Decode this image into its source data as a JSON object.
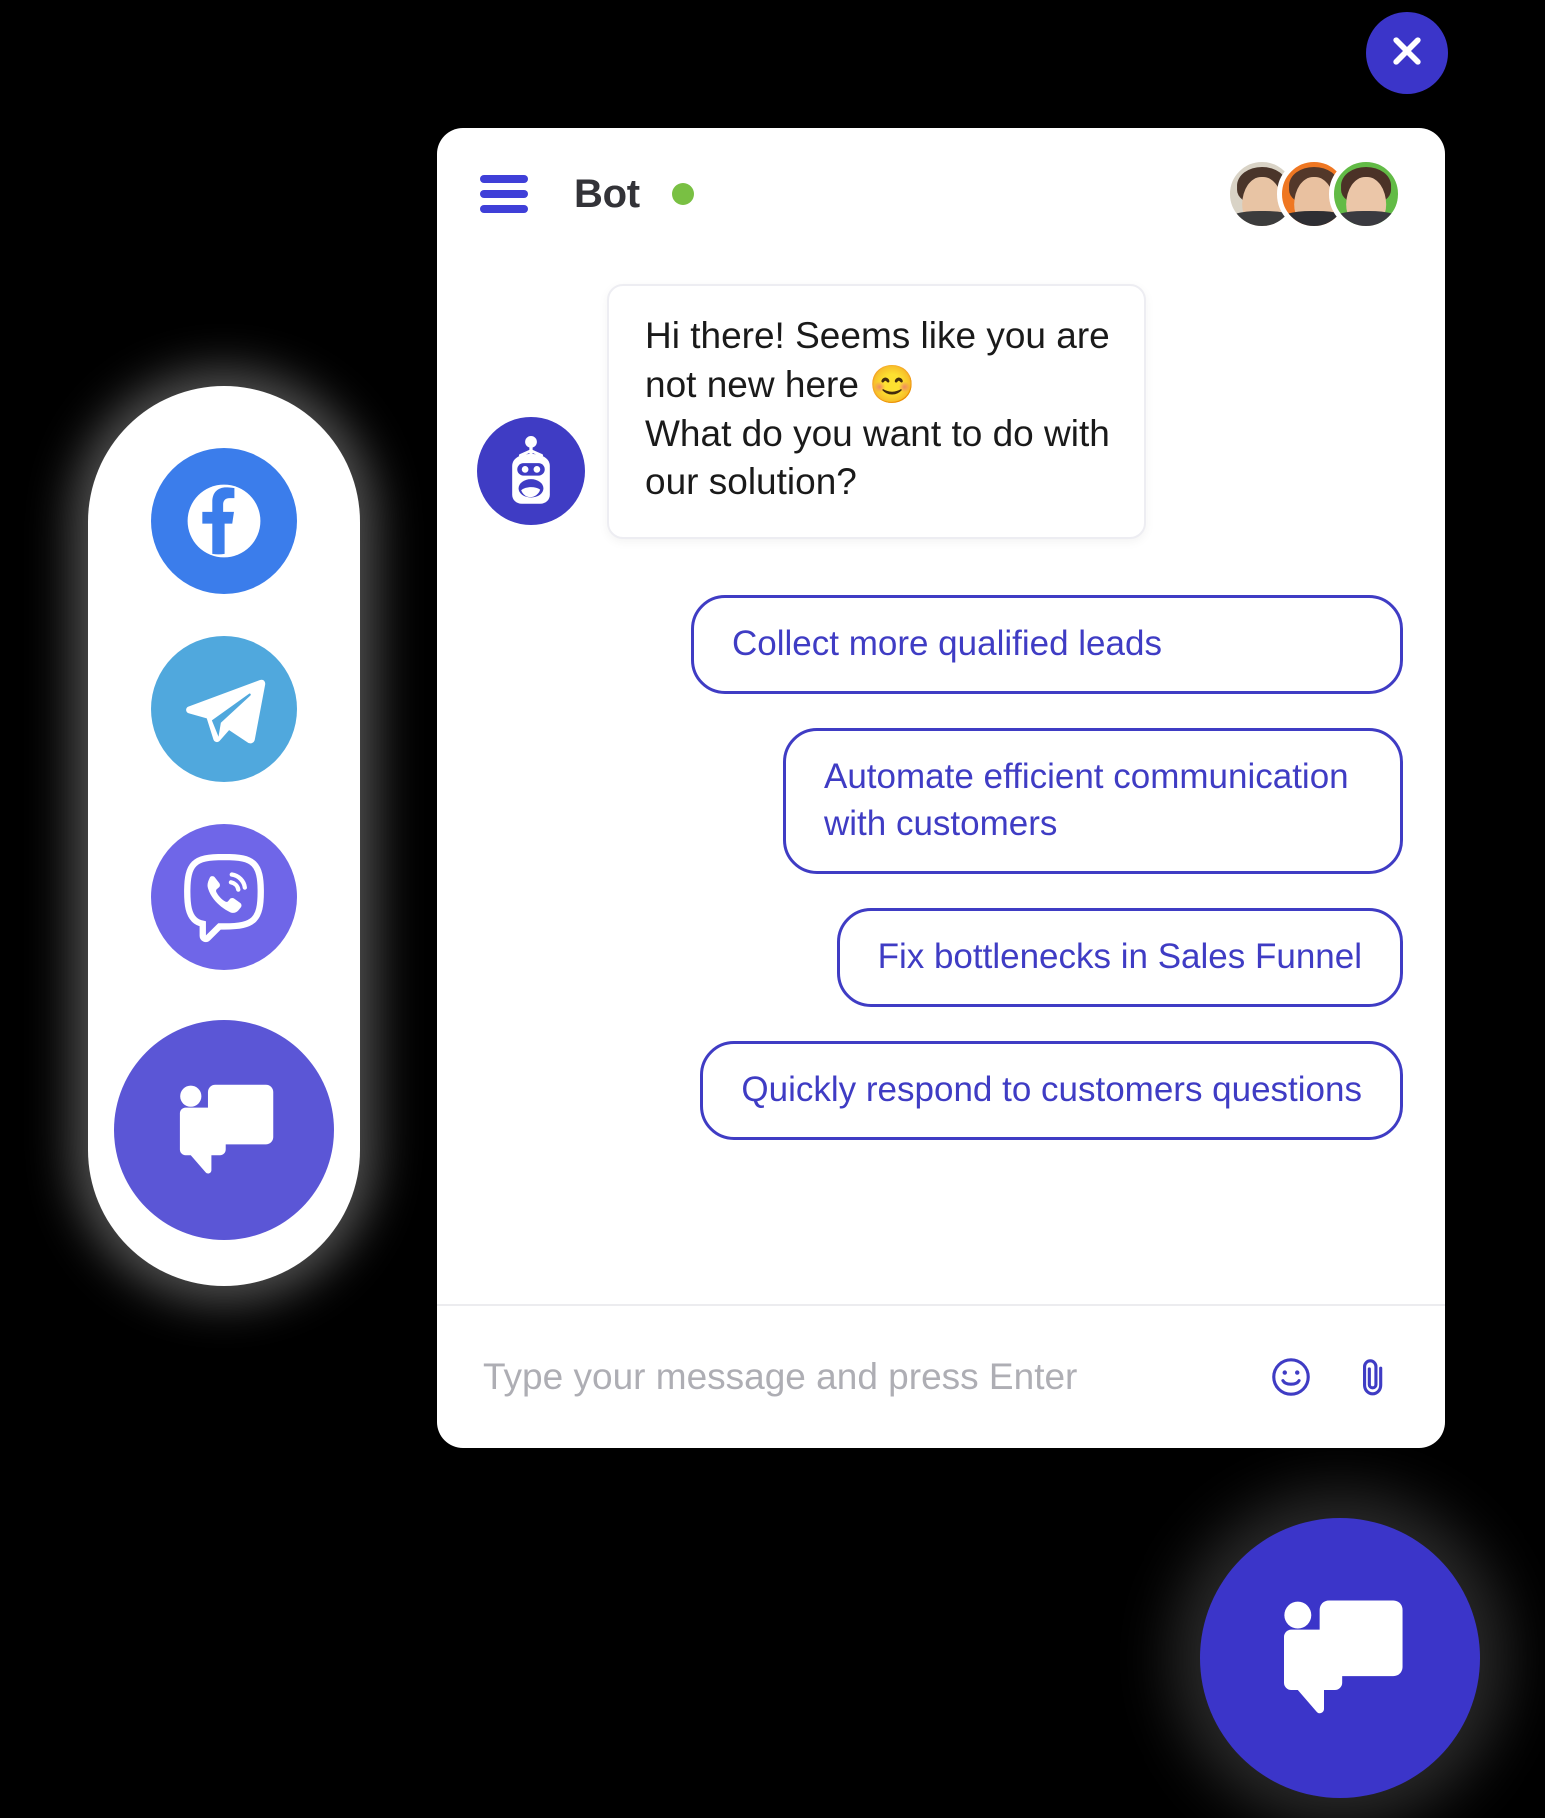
{
  "close_button": {
    "icon": "close-icon",
    "color": "#3B35C9"
  },
  "widget": {
    "header": {
      "menu_icon": "hamburger-menu-icon",
      "title": "Bot",
      "status": "online",
      "status_color": "#79C043",
      "agents": [
        {
          "name": "agent-1",
          "ring_color": "#D9D3C6",
          "hair": "#4A352A",
          "skin": "#E8C4A4"
        },
        {
          "name": "agent-2",
          "ring_color": "#EF7722",
          "hair": "#53382A",
          "skin": "#E9C1A0"
        },
        {
          "name": "agent-3",
          "ring_color": "#62BB46",
          "hair": "#4B3227",
          "skin": "#EBC6A8"
        }
      ]
    },
    "conversation": {
      "bot_avatar_icon": "robot-icon",
      "bot_avatar_color": "#3F3CC4",
      "message_lines": [
        "Hi there! Seems like you are",
        "not new here 😊",
        "What do you want to do with",
        "our solution?"
      ]
    },
    "quick_replies": [
      {
        "label": "Collect more qualified leads",
        "full_width": true
      },
      {
        "label": "Automate efficient communication with customers",
        "full_width": false
      },
      {
        "label": "Fix bottlenecks in Sales Funnel",
        "full_width": false
      },
      {
        "label": "Quickly respond to customers questions",
        "full_width": false
      }
    ],
    "composer": {
      "placeholder": "Type your message and press Enter",
      "emoji_icon": "smiley-icon",
      "attach_icon": "paperclip-icon",
      "icon_color": "#3F3CC4"
    },
    "accent_color": "#3F3CC4"
  },
  "channel_sidebar": {
    "items": [
      {
        "name": "facebook",
        "label": "Facebook",
        "color": "#3B7DEB"
      },
      {
        "name": "telegram",
        "label": "Telegram",
        "color": "#50A8DD"
      },
      {
        "name": "viber",
        "label": "Viber",
        "color": "#6F66E8"
      },
      {
        "name": "chat",
        "label": "Chat",
        "color": "#5B56D6"
      }
    ]
  },
  "floating_launcher": {
    "icon": "chat-bubble-icon",
    "color": "#3B35C9"
  }
}
